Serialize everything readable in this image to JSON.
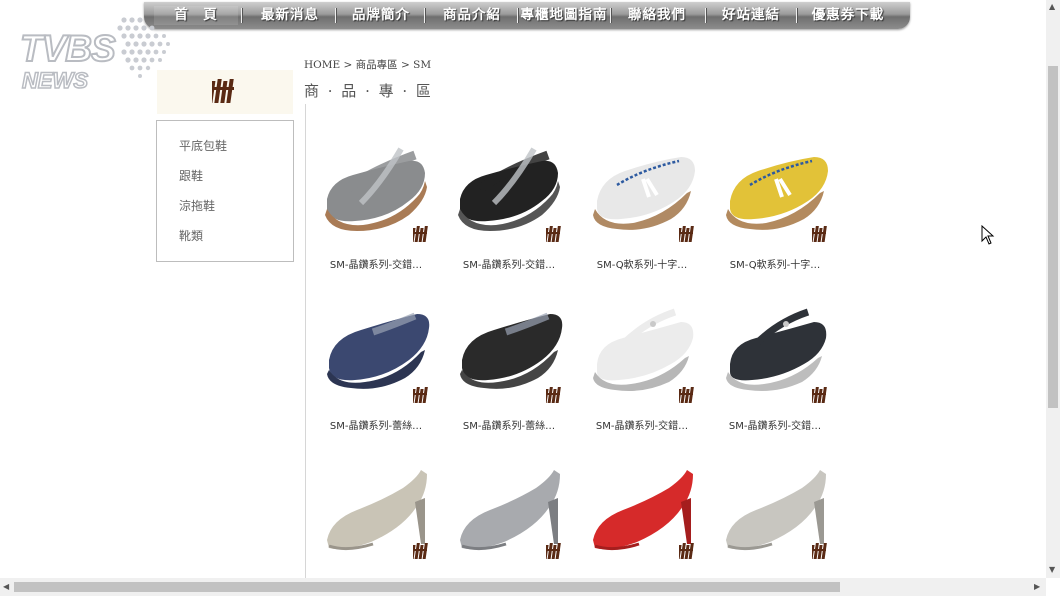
{
  "nav": {
    "items": [
      "首　頁",
      "最新消息",
      "品牌簡介",
      "商品介紹",
      "專櫃地圖指南",
      "聯絡我們",
      "好站連結",
      "優惠券下載"
    ]
  },
  "watermark": {
    "brand": "TVBS",
    "sub": "NEWS"
  },
  "sidebar": {
    "logo": "SM",
    "items": [
      "平底包鞋",
      "跟鞋",
      "涼拖鞋",
      "靴類"
    ]
  },
  "breadcrumb": "HOME > 商品專區 > SM",
  "section_title": "商 · 品 · 專 · 區",
  "products": [
    {
      "name": "SM-晶鑽系列-交錯…",
      "shoe": "mary-jane",
      "color": "#8a8c8e",
      "sole": "#a97b55"
    },
    {
      "name": "SM-晶鑽系列-交錯…",
      "shoe": "mary-jane",
      "color": "#222222",
      "sole": "#555555"
    },
    {
      "name": "SM-Q軟系列-十字…",
      "shoe": "loafer",
      "color": "#e8e8e8",
      "sole": "#b08a64"
    },
    {
      "name": "SM-Q軟系列-十字…",
      "shoe": "loafer",
      "color": "#e2c238",
      "sole": "#b38a5e"
    },
    {
      "name": "SM-晶鑽系列-蕾絲…",
      "shoe": "slipon",
      "color": "#3b4870",
      "sole": "#2c3552"
    },
    {
      "name": "SM-晶鑽系列-蕾絲…",
      "shoe": "slipon",
      "color": "#2a2a2a",
      "sole": "#444444"
    },
    {
      "name": "SM-晶鑽系列-交錯…",
      "shoe": "strap",
      "color": "#ececec",
      "sole": "#b7b7b7"
    },
    {
      "name": "SM-晶鑽系列-交錯…",
      "shoe": "strap",
      "color": "#2e3238",
      "sole": "#bdbdbd"
    },
    {
      "name": "",
      "shoe": "pump",
      "color": "#c9c4b6",
      "sole": "#9a958b"
    },
    {
      "name": "",
      "shoe": "pump",
      "color": "#a8aaae",
      "sole": "#7c7e82"
    },
    {
      "name": "",
      "shoe": "pump",
      "color": "#d62a2a",
      "sole": "#a51e1e"
    },
    {
      "name": "",
      "shoe": "pump",
      "color": "#c8c6c0",
      "sole": "#9b9993"
    }
  ]
}
